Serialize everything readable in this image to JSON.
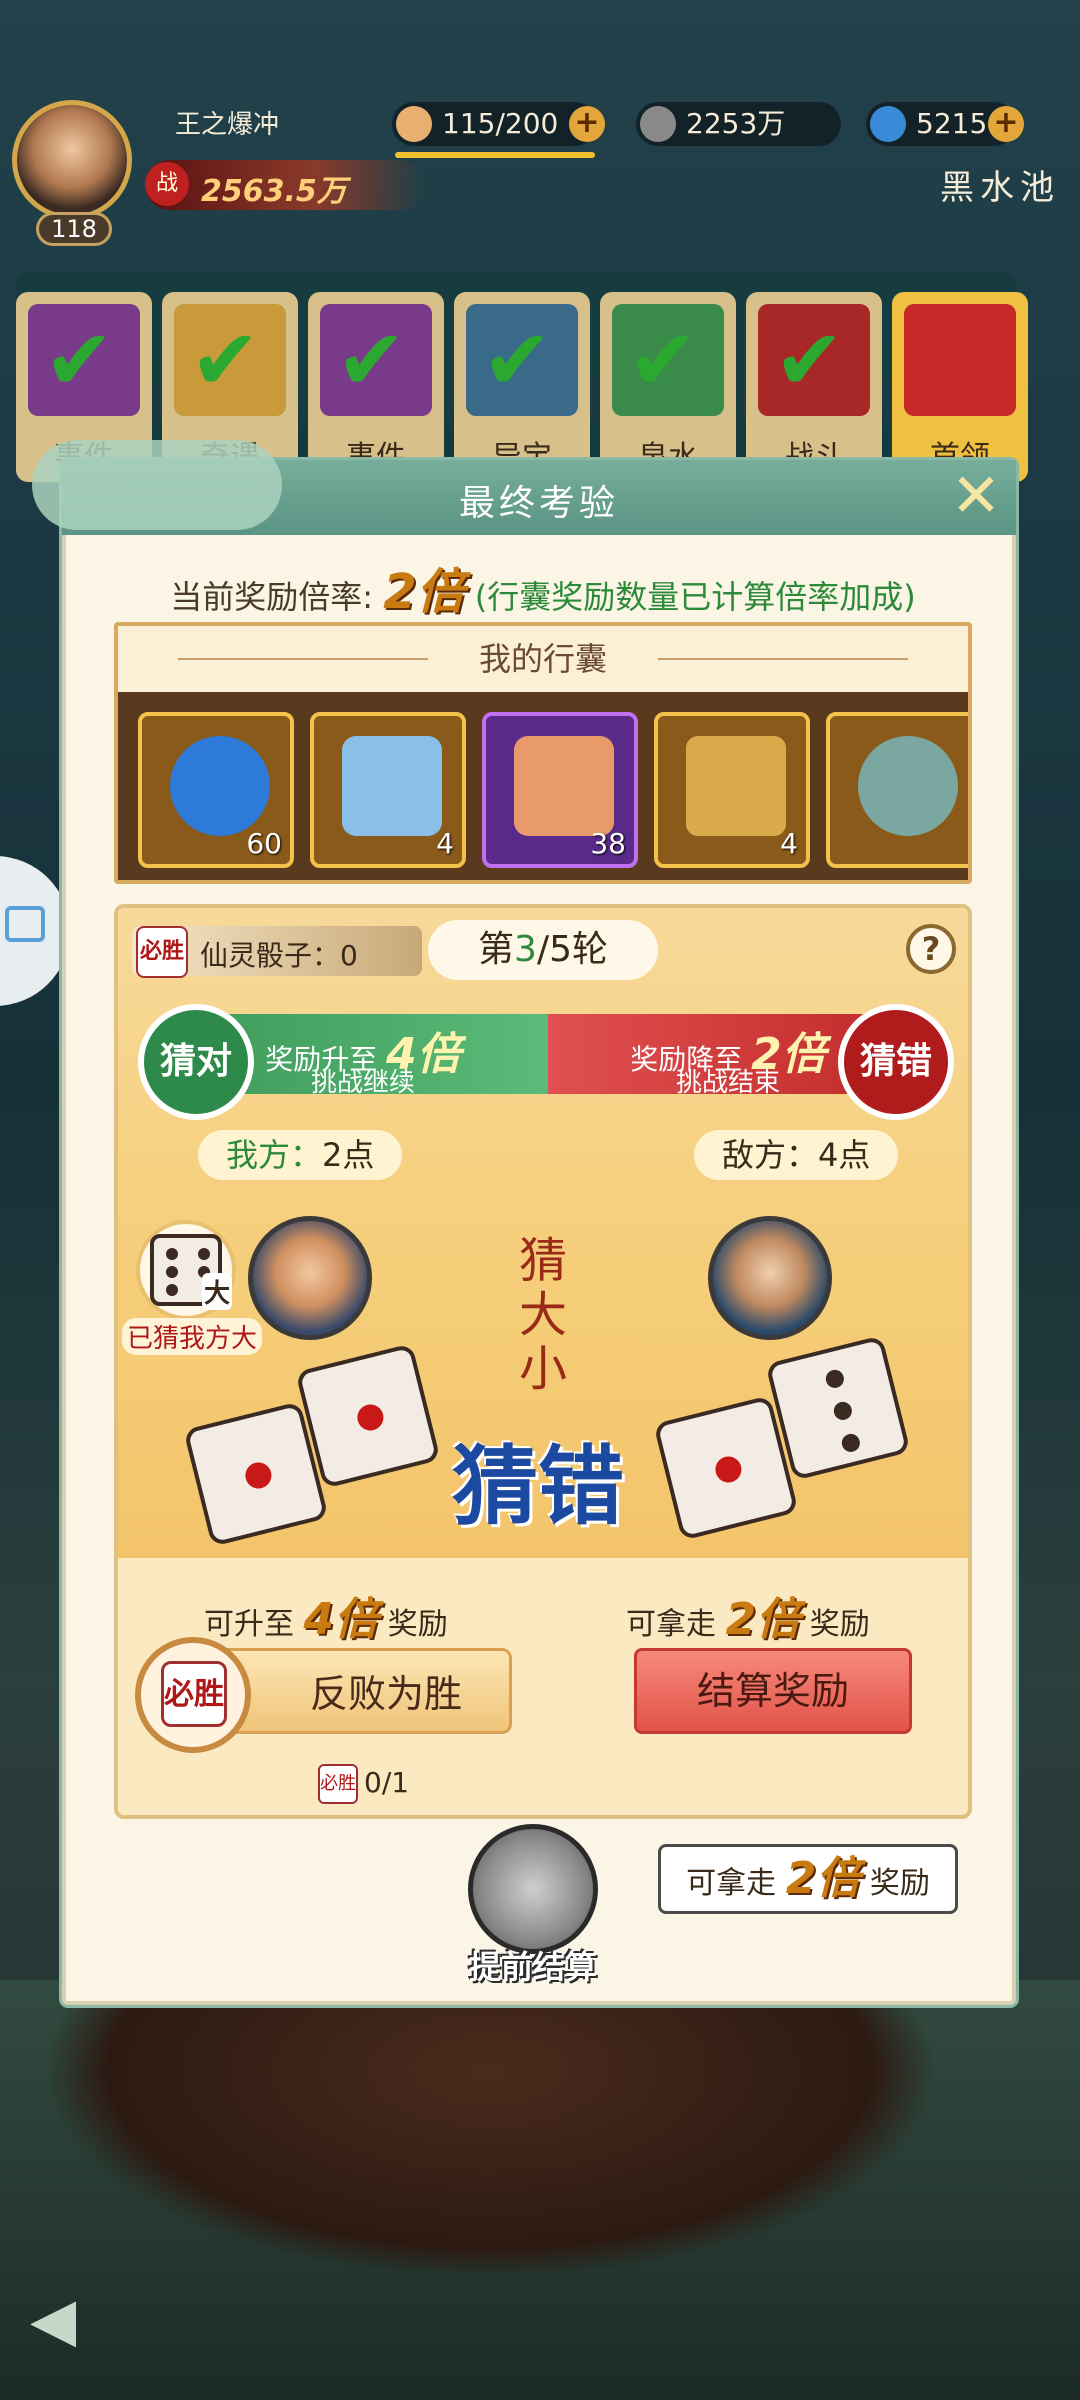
{
  "player": {
    "name": "王之爆冲",
    "level": "118",
    "power_badge": "战",
    "power": "2563.5万"
  },
  "resources": [
    {
      "name": "stamina",
      "value": "115/200",
      "icon": "bun-icon"
    },
    {
      "name": "coins",
      "value": "2253万",
      "icon": "coin-icon"
    },
    {
      "name": "jade",
      "value": "5215",
      "icon": "swirl-icon"
    }
  ],
  "location": "黑水池",
  "event_tiles": [
    {
      "label": "事件",
      "color": "#7a3a8a"
    },
    {
      "label": "奇遇",
      "color": "#c89a3a"
    },
    {
      "label": "事件",
      "color": "#7a3a8a"
    },
    {
      "label": "异宝",
      "color": "#3a6a8a"
    },
    {
      "label": "泉水",
      "color": "#3a8a4a"
    },
    {
      "label": "战斗",
      "color": "#a82828"
    },
    {
      "label": "首领",
      "color": "#c82828"
    }
  ],
  "dialog": {
    "title": "最终考验",
    "rate_prefix": "当前奖励倍率:",
    "rate_value": "2倍",
    "rate_note": "(行囊奖励数量已计算倍率加成)",
    "bag_title": "我的行囊",
    "bag_items": [
      {
        "name": "jade-ring",
        "count": "60",
        "color": "#2e7ad8"
      },
      {
        "name": "dragon-puzzle",
        "count": "4",
        "color": "#8ac0e8"
      },
      {
        "name": "fox-puzzle",
        "count": "38",
        "color": "#e89a6a"
      },
      {
        "name": "treasure-chest",
        "count": "4",
        "color": "#d8aa4a"
      },
      {
        "name": "stone-bowl",
        "count": "",
        "color": "#7aa8a0"
      }
    ]
  },
  "game": {
    "dice_label": "仙灵骰子：0",
    "dice_badge": "必胜",
    "round_prefix": "第",
    "round_current": "3",
    "round_suffix": "/5轮",
    "help": "?",
    "guess_right": {
      "button": "猜对",
      "top_prefix": "奖励升至",
      "top_value": "4倍",
      "bottom": "挑战继续"
    },
    "guess_wrong": {
      "button": "猜错",
      "top_prefix": "奖励降至",
      "top_value": "2倍",
      "bottom": "挑战结束"
    },
    "my_score": {
      "label": "我方：",
      "value": "2点"
    },
    "enemy_score": {
      "label": "敌方：",
      "value": "4点"
    },
    "guessed_badge": "大",
    "guessed_label": "已猜我方大",
    "prompt": [
      "猜",
      "大",
      "小"
    ],
    "result": "猜错",
    "reward_up": {
      "prefix": "可升至",
      "value": "4倍",
      "suffix": "奖励"
    },
    "reward_take": {
      "prefix": "可拿走",
      "value": "2倍",
      "suffix": "奖励"
    },
    "reverse_button": "反败为胜",
    "reverse_badge": "必胜",
    "reverse_count": "0/1",
    "settle_button": "结算奖励"
  },
  "early": {
    "label": "提前结算",
    "tip_prefix": "可拿走",
    "tip_value": "2倍",
    "tip_suffix": "奖励"
  }
}
